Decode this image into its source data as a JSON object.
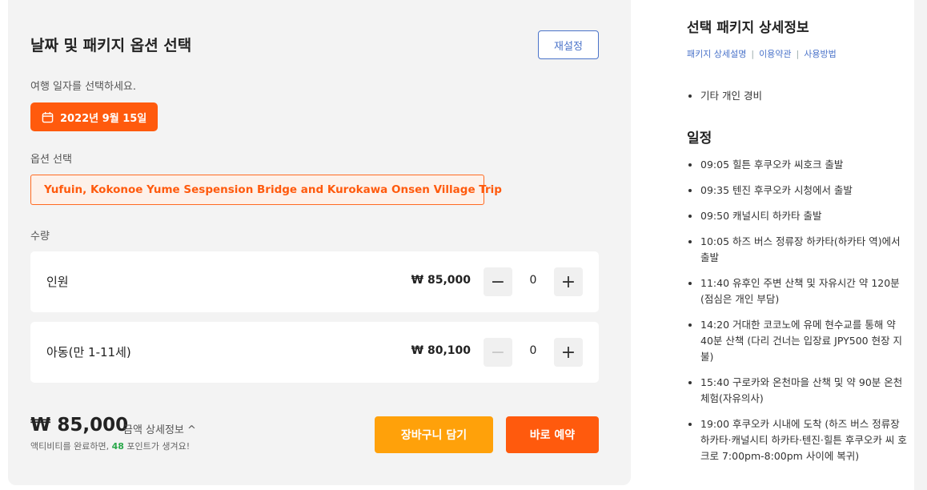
{
  "left": {
    "title": "날짜 및 패키지 옵션 선택",
    "reset_label": "재설정",
    "date_prompt": "여행 일자를 선택하세요.",
    "selected_date": "2022년 9월 15일",
    "option_label": "옵션 선택",
    "selected_option": "Yufuin, Kokonoe Yume Sespension Bridge and Kurokawa Onsen Village Trip",
    "quantity_label": "수량",
    "rows": [
      {
        "label": "인원",
        "price": "₩ 85,000",
        "qty": "0",
        "minus": "−",
        "plus": "+"
      },
      {
        "label": "아동(만 1-11세)",
        "price": "₩ 80,100",
        "qty": "0",
        "minus": "−",
        "plus": "+"
      }
    ],
    "total": "₩ 85,000",
    "detail_link": "금액 상세정보 ^",
    "points_prefix": "액티비티를 완료하면, ",
    "points_value": "48",
    "points_suffix": " 포인트가 생겨요!",
    "cart_button": "장바구니 담기",
    "book_button": "바로 예약"
  },
  "right": {
    "title": "선택 패키지 상세정보",
    "tabs": [
      "패키지 상세설명",
      "이용약관",
      "사용방법"
    ],
    "tab_separator": "|",
    "extras": [
      "기타 개인 경비"
    ],
    "schedule_title": "일정",
    "schedule": [
      "09:05 힐튼 후쿠오카 씨호크 출발",
      "09:35 텐진 후쿠오카 시청에서 출발",
      "09:50 캐널시티 하카타 출발",
      "10:05 하즈 버스 정류장 하카타(하카타 역)에서 출발",
      "11:40 유후인 주변 산책 및 자유시간 약 120분 (점심은 개인 부담)",
      "14:20 거대한 코코노에 유메 현수교를 통해 약 40분 산책 (다리 건너는 입장료 JPY500 현장 지불)",
      "15:40 구로카와 온천마을 산책 및 약 90분 온천체험(자유의사)",
      "19:00 후쿠오카 시내에 도착 (하즈 버스 정류장 하카타·캐널시티 하카타·텐진·힐튼 후쿠오카 씨 호크로 7:00pm-8:00pm 사이에 복귀)"
    ]
  },
  "colors": {
    "accent": "#ff5a0d",
    "cart": "#ffa10a",
    "link": "#4a73c9",
    "points": "#2aa84a"
  },
  "icons": {
    "date": "calendar-icon"
  }
}
